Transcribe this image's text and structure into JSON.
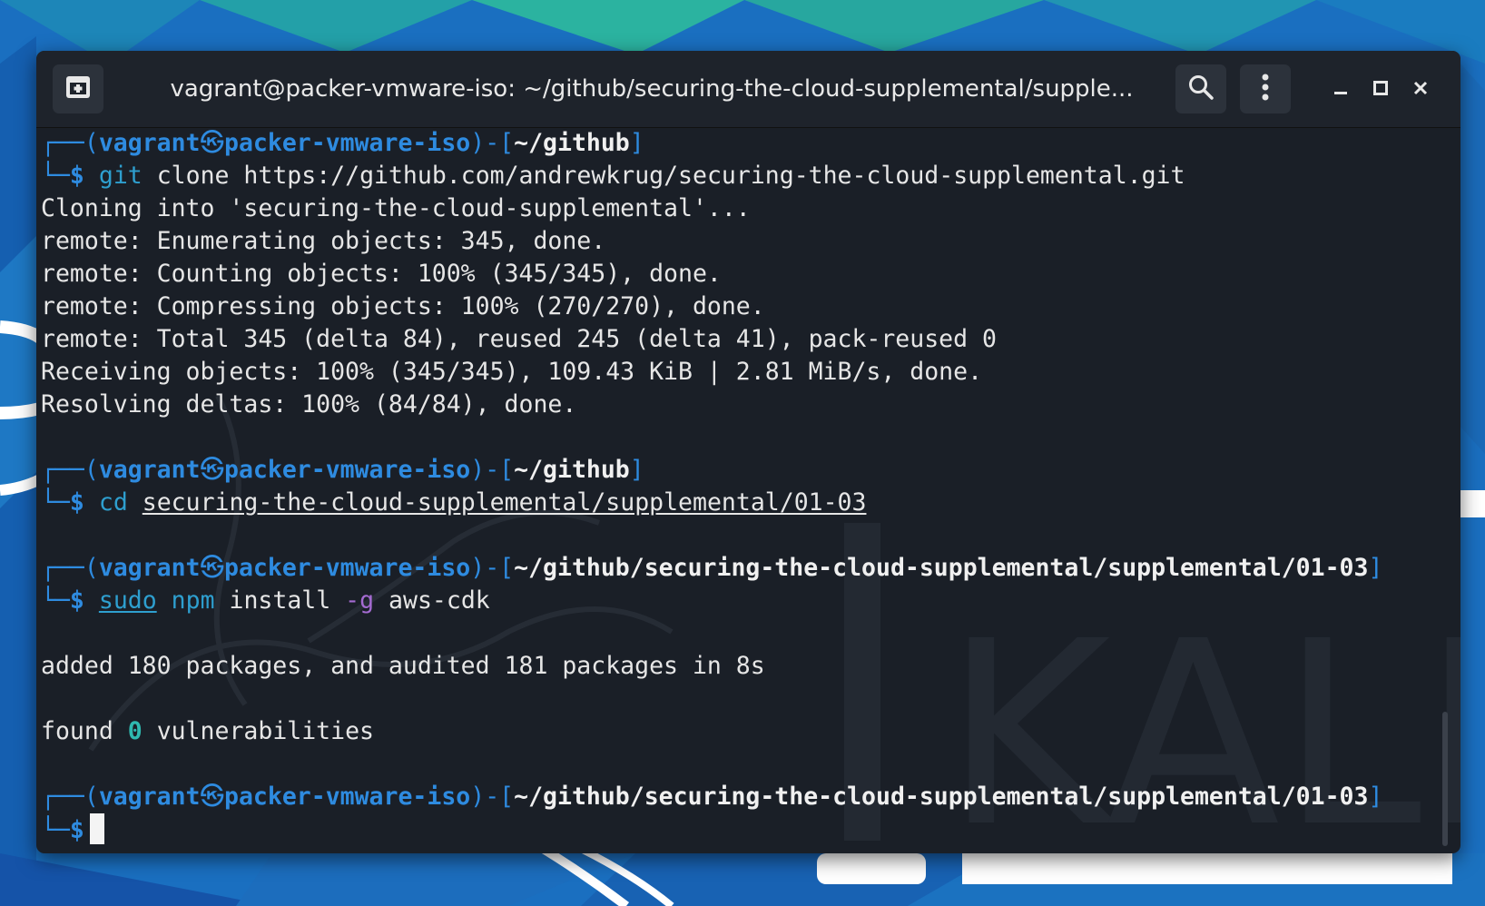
{
  "window": {
    "title": "vagrant@packer-vmware-iso: ~/github/securing-the-cloud-supplemental/supple...",
    "buttons": {
      "new_tab_icon": "new-tab-icon",
      "search_icon": "search-icon",
      "menu_icon": "kebab-menu-icon",
      "minimize_icon": "minimize-icon",
      "maximize_icon": "maximize-icon",
      "close_icon": "close-icon"
    }
  },
  "terminal": {
    "prompt": {
      "frame_top": "┌──(",
      "user": "vagrant",
      "at_symbol": "㉿",
      "host": "packer-vmware-iso",
      "sep": ")-[",
      "close": "]",
      "frame_bottom": "└─",
      "dollar": "$"
    },
    "blocks": [
      {
        "path": "~/github",
        "command": "git",
        "args": "clone https://github.com/andrewkrug/securing-the-cloud-supplemental.git",
        "output": [
          "Cloning into 'securing-the-cloud-supplemental'...",
          "remote: Enumerating objects: 345, done.",
          "remote: Counting objects: 100% (345/345), done.",
          "remote: Compressing objects: 100% (270/270), done.",
          "remote: Total 345 (delta 84), reused 245 (delta 41), pack-reused 0",
          "Receiving objects: 100% (345/345), 109.43 KiB | 2.81 MiB/s, done.",
          "Resolving deltas: 100% (84/84), done."
        ]
      },
      {
        "path": "~/github",
        "command": "cd",
        "args": "securing-the-cloud-supplemental/supplemental/01-03"
      },
      {
        "path": "~/github/securing-the-cloud-supplemental/supplemental/01-03",
        "command_sudo": "sudo",
        "command": "npm",
        "args_pre": "install",
        "flag": "-g",
        "args_post": "aws-cdk",
        "output_added": "added 180 packages, and audited 181 packages in 8s",
        "output_found_pre": "found",
        "output_found_num": "0",
        "output_found_post": "vulnerabilities"
      },
      {
        "path": "~/github/securing-the-cloud-supplemental/supplemental/01-03"
      }
    ]
  },
  "colors": {
    "prompt_blue": "#2e8be0",
    "command_cyan": "#2e9fcf",
    "flag_purple": "#a46bd1",
    "count_green": "#2fb9b0",
    "terminal_bg": "#1a1f27",
    "titlebar_bg": "#1e232b"
  }
}
